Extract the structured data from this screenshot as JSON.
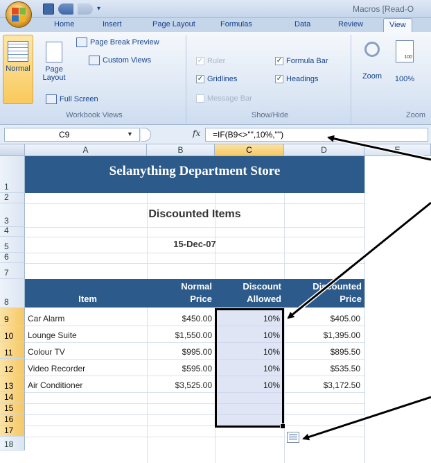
{
  "window": {
    "title": "Macros [Read-O",
    "office_button_icon": "office-logo-icon",
    "qat": [
      "save-icon",
      "undo-icon",
      "redo-icon",
      "customize-qat-icon"
    ]
  },
  "tabs": [
    {
      "label": "Home"
    },
    {
      "label": "Insert"
    },
    {
      "label": "Page Layout"
    },
    {
      "label": "Formulas"
    },
    {
      "label": "Data"
    },
    {
      "label": "Review"
    },
    {
      "label": "View",
      "active": true
    }
  ],
  "ribbon": {
    "workbook_views": {
      "label": "Workbook Views",
      "normal": "Normal",
      "page_layout_line1": "Page",
      "page_layout_line2": "Layout",
      "page_break_preview": "Page Break Preview",
      "custom_views": "Custom Views",
      "full_screen": "Full Screen"
    },
    "show_hide": {
      "label": "Show/Hide",
      "ruler": "Ruler",
      "gridlines": "Gridlines",
      "message_bar": "Message Bar",
      "formula_bar": "Formula Bar",
      "headings": "Headings"
    },
    "zoom": {
      "label": "Zoom",
      "zoom_button": "Zoom",
      "zoom_100": "100%",
      "badge_100": "100"
    }
  },
  "formula_bar": {
    "name_box": "C9",
    "fx": "fx",
    "formula": "=IF(B9<>\"\",10%,\"\")"
  },
  "columns": [
    "A",
    "B",
    "C",
    "D",
    "E"
  ],
  "rows": [
    "1",
    "2",
    "3",
    "4",
    "5",
    "6",
    "7",
    "8",
    "9",
    "10",
    "11",
    "12",
    "13",
    "14",
    "15",
    "16",
    "17",
    "18"
  ],
  "sheet": {
    "store_name": "Selanything Department Store",
    "subtitle": "Discounted Items",
    "date": "15-Dec-07",
    "headers": {
      "item": "Item",
      "normal_line1": "Normal",
      "normal_line2": "Price",
      "discount_line1": "Discount",
      "discount_line2": "Allowed",
      "discounted_line1": "Discounted",
      "discounted_line2": "Price"
    },
    "items": [
      {
        "item": "Car Alarm",
        "normal": "$450.00",
        "discount": "10%",
        "discounted": "$405.00"
      },
      {
        "item": "Lounge Suite",
        "normal": "$1,550.00",
        "discount": "10%",
        "discounted": "$1,395.00"
      },
      {
        "item": "Colour TV",
        "normal": "$995.00",
        "discount": "10%",
        "discounted": "$895.50"
      },
      {
        "item": "Video Recorder",
        "normal": "$595.00",
        "discount": "10%",
        "discounted": "$535.50"
      },
      {
        "item": "Air Conditioner",
        "normal": "$3,525.00",
        "discount": "10%",
        "discounted": "$3,172.50"
      }
    ]
  },
  "colors": {
    "banner": "#2c5a8a",
    "selection": "#c4d0ec",
    "header_highlight": "#f7c763"
  }
}
